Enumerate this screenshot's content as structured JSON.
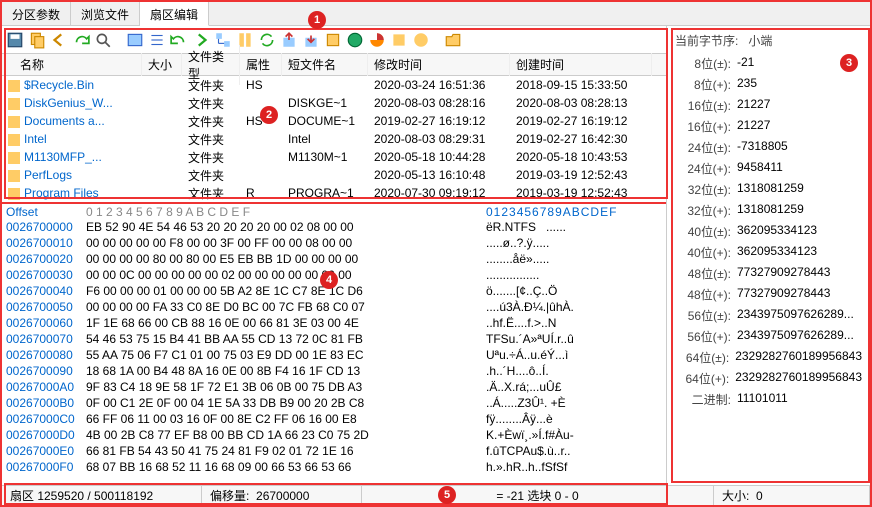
{
  "tabs": [
    "分区参数",
    "浏览文件",
    "扇区编辑"
  ],
  "toolbar_icons": [
    "save",
    "copy",
    "back",
    "redo",
    "search",
    "view",
    "list",
    "undo2",
    "fwd",
    "tree",
    "col",
    "refresh",
    "export",
    "import",
    "marker",
    "world",
    "pie",
    "tools",
    "help",
    "open"
  ],
  "file_headers": {
    "name": "名称",
    "size": "大小",
    "type": "文件类型",
    "attr": "属性",
    "sname": "短文件名",
    "mtime": "修改时间",
    "ctime": "创建时间"
  },
  "files": [
    {
      "name": "$Recycle.Bin",
      "type": "文件夹",
      "attr": "HS",
      "sname": "",
      "mtime": "2020-03-24 16:51:36",
      "ctime": "2018-09-15 15:33:50"
    },
    {
      "name": "DiskGenius_W...",
      "type": "文件夹",
      "attr": "",
      "sname": "DISKGE~1",
      "mtime": "2020-08-03 08:28:16",
      "ctime": "2020-08-03 08:28:13"
    },
    {
      "name": "Documents a...",
      "type": "文件夹",
      "attr": "HS",
      "sname": "DOCUME~1",
      "mtime": "2019-02-27 16:19:12",
      "ctime": "2019-02-27 16:19:12"
    },
    {
      "name": "Intel",
      "type": "文件夹",
      "attr": "",
      "sname": "Intel",
      "mtime": "2020-08-03 08:29:31",
      "ctime": "2019-02-27 16:42:30"
    },
    {
      "name": "M1130MFP_...",
      "type": "文件夹",
      "attr": "",
      "sname": "M1130M~1",
      "mtime": "2020-05-18 10:44:28",
      "ctime": "2020-05-18 10:43:53"
    },
    {
      "name": "PerfLogs",
      "type": "文件夹",
      "attr": "",
      "sname": "",
      "mtime": "2020-05-13 16:10:48",
      "ctime": "2019-03-19 12:52:43"
    },
    {
      "name": "Program Files",
      "type": "文件夹",
      "attr": "R",
      "sname": "PROGRA~1",
      "mtime": "2020-07-30 09:19:12",
      "ctime": "2019-03-19 12:52:43"
    }
  ],
  "hex": {
    "header_offset": "Offset",
    "header_bytes": " 0  1  2  3  4  5  6  7  8  9  A  B  C  D  E  F",
    "header_ascii": "0123456789ABCDEF",
    "rows": [
      {
        "o": "0026700000",
        "b": "EB 52 90 4E 54 46 53 20 20 20 20 00 02 08 00 00",
        "a": "ëR.NTFS   ......"
      },
      {
        "o": "0026700010",
        "b": "00 00 00 00 00 F8 00 00 3F 00 FF 00 00 08 00 00",
        "a": ".....ø..?.ÿ....."
      },
      {
        "o": "0026700020",
        "b": "00 00 00 00 80 00 80 00 E5 EB BB 1D 00 00 00 00",
        "a": "........åë»....."
      },
      {
        "o": "0026700030",
        "b": "00 00 0C 00 00 00 00 00 02 00 00 00 00 00 00 00",
        "a": "................"
      },
      {
        "o": "0026700040",
        "b": "F6 00 00 00 01 00 00 00 5B A2 8E 1C C7 8E 1C D6",
        "a": "ö.......[¢..Ç..Ö"
      },
      {
        "o": "0026700050",
        "b": "00 00 00 00 FA 33 C0 8E D0 BC 00 7C FB 68 C0 07",
        "a": "....ú3À.Ð¼.|ûhÀ."
      },
      {
        "o": "0026700060",
        "b": "1F 1E 68 66 00 CB 88 16 0E 00 66 81 3E 03 00 4E",
        "a": "..hf.Ë....f.>..N"
      },
      {
        "o": "0026700070",
        "b": "54 46 53 75 15 B4 41 BB AA 55 CD 13 72 0C 81 FB",
        "a": "TFSu.´A»ªUÍ.r..û"
      },
      {
        "o": "0026700080",
        "b": "55 AA 75 06 F7 C1 01 00 75 03 E9 DD 00 1E 83 EC",
        "a": "Uªu.÷Á..u.éÝ...ì"
      },
      {
        "o": "0026700090",
        "b": "18 68 1A 00 B4 48 8A 16 0E 00 8B F4 16 1F CD 13",
        "a": ".h..´H....ô..Í."
      },
      {
        "o": "00267000A0",
        "b": "9F 83 C4 18 9E 58 1F 72 E1 3B 06 0B 00 75 DB A3",
        "a": ".Ä..X.rá;...uÛ£"
      },
      {
        "o": "00267000B0",
        "b": "0F 00 C1 2E 0F 00 04 1E 5A 33 DB B9 00 20 2B C8",
        "a": "..Á.....Z3Û¹. +È"
      },
      {
        "o": "00267000C0",
        "b": "66 FF 06 11 00 03 16 0F 00 8E C2 FF 06 16 00 E8",
        "a": "fÿ........Âÿ...è"
      },
      {
        "o": "00267000D0",
        "b": "4B 00 2B C8 77 EF B8 00 BB CD 1A 66 23 C0 75 2D",
        "a": "K.+Èwï¸.»Í.f#Àu-"
      },
      {
        "o": "00267000E0",
        "b": "66 81 FB 54 43 50 41 75 24 81 F9 02 01 72 1E 16",
        "a": "f.ûTCPAu$.ù..r.."
      },
      {
        "o": "00267000F0",
        "b": "68 07 BB 16 68 52 11 16 68 09 00 66 53 66 53 66",
        "a": "h.».hR..h..fSfSf"
      }
    ]
  },
  "status": {
    "sector": "扇区 1259520 / 500118192",
    "offset_label": "偏移量:",
    "offset_val": "26700000",
    "eq": "= -21 选块 0 - 0",
    "size_label": "大小:",
    "size_val": "0"
  },
  "right": {
    "title_label": "当前字节序:",
    "title_val": "小端",
    "rows": [
      {
        "k": "8位(±):",
        "v": "-21"
      },
      {
        "k": "8位(+):",
        "v": "235"
      },
      {
        "k": "16位(±):",
        "v": "21227"
      },
      {
        "k": "16位(+):",
        "v": "21227"
      },
      {
        "k": "24位(±):",
        "v": "-7318805"
      },
      {
        "k": "24位(+):",
        "v": "9458411"
      },
      {
        "k": "32位(±):",
        "v": "1318081259"
      },
      {
        "k": "32位(+):",
        "v": "1318081259"
      },
      {
        "k": "40位(±):",
        "v": "362095334123"
      },
      {
        "k": "40位(+):",
        "v": "362095334123"
      },
      {
        "k": "48位(±):",
        "v": "77327909278443"
      },
      {
        "k": "48位(+):",
        "v": "77327909278443"
      },
      {
        "k": "56位(±):",
        "v": "2343975097626289..."
      },
      {
        "k": "56位(+):",
        "v": "2343975097626289..."
      },
      {
        "k": "64位(±):",
        "v": "2329282760189956843"
      },
      {
        "k": "64位(+):",
        "v": "2329282760189956843"
      },
      {
        "k": "二进制:",
        "v": "11101011"
      }
    ]
  }
}
